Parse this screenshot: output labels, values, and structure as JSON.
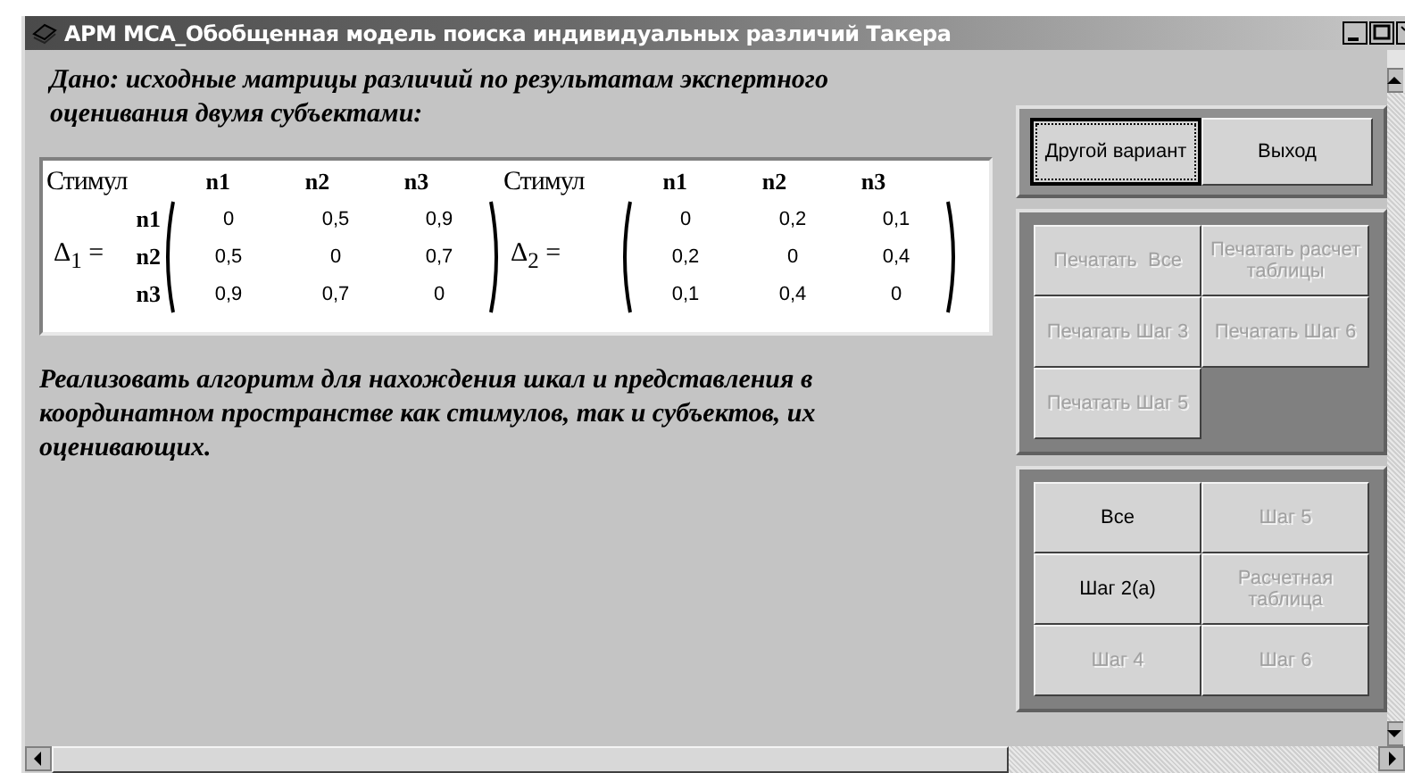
{
  "window": {
    "title": "АРМ МСА_Обобщенная модель поиска индивидуальных различий Такера"
  },
  "task_text": "Дано: исходные матрицы различий по результатам экспертного оценивания двумя субъектами:",
  "matrices": [
    {
      "stimulus_header": "Стимул",
      "columns": [
        "n1",
        "n2",
        "n3"
      ],
      "label": "Δ$_{1}$ =",
      "row_labels": [
        "n1",
        "n2",
        "n3"
      ],
      "rows": [
        [
          "0",
          "0,5",
          "0,9"
        ],
        [
          "0,5",
          "0",
          "0,7"
        ],
        [
          "0,9",
          "0,7",
          "0"
        ]
      ]
    },
    {
      "stimulus_header": "Стимул",
      "columns": [
        "n1",
        "n2",
        "n3"
      ],
      "label": "Δ$_{2}$ =",
      "rows": [
        [
          "0",
          "0,2",
          "0,1"
        ],
        [
          "0,2",
          "0",
          "0,4"
        ],
        [
          "0,1",
          "0,4",
          "0"
        ]
      ]
    }
  ],
  "goal_text": "Реализовать алгоритм для нахождения шкал и представления в координатном пространстве как стимулов, так и субъектов, их оценивающих.",
  "main_buttons": [
    {
      "label": "Другой вариант",
      "focused": true
    },
    {
      "label": "Выход",
      "focused": false
    }
  ],
  "print_buttons": [
    {
      "label": "Печатать  Все",
      "disabled": true
    },
    {
      "label": "Печатать расчет таблицы",
      "disabled": true
    },
    {
      "label": "Печатать Шаг 3",
      "disabled": true
    },
    {
      "label": "Печатать Шаг 6",
      "disabled": true
    },
    {
      "label": "Печатать Шаг 5",
      "disabled": true
    }
  ],
  "step_buttons": [
    {
      "label": "Все",
      "disabled": false
    },
    {
      "label": "Шаг 5",
      "disabled": true
    },
    {
      "label": "Шаг 2(а)",
      "disabled": false
    },
    {
      "label": "Расчетная таблица",
      "disabled": true
    },
    {
      "label": "Шаг 4",
      "disabled": true
    },
    {
      "label": "Шаг 6",
      "disabled": true
    }
  ]
}
